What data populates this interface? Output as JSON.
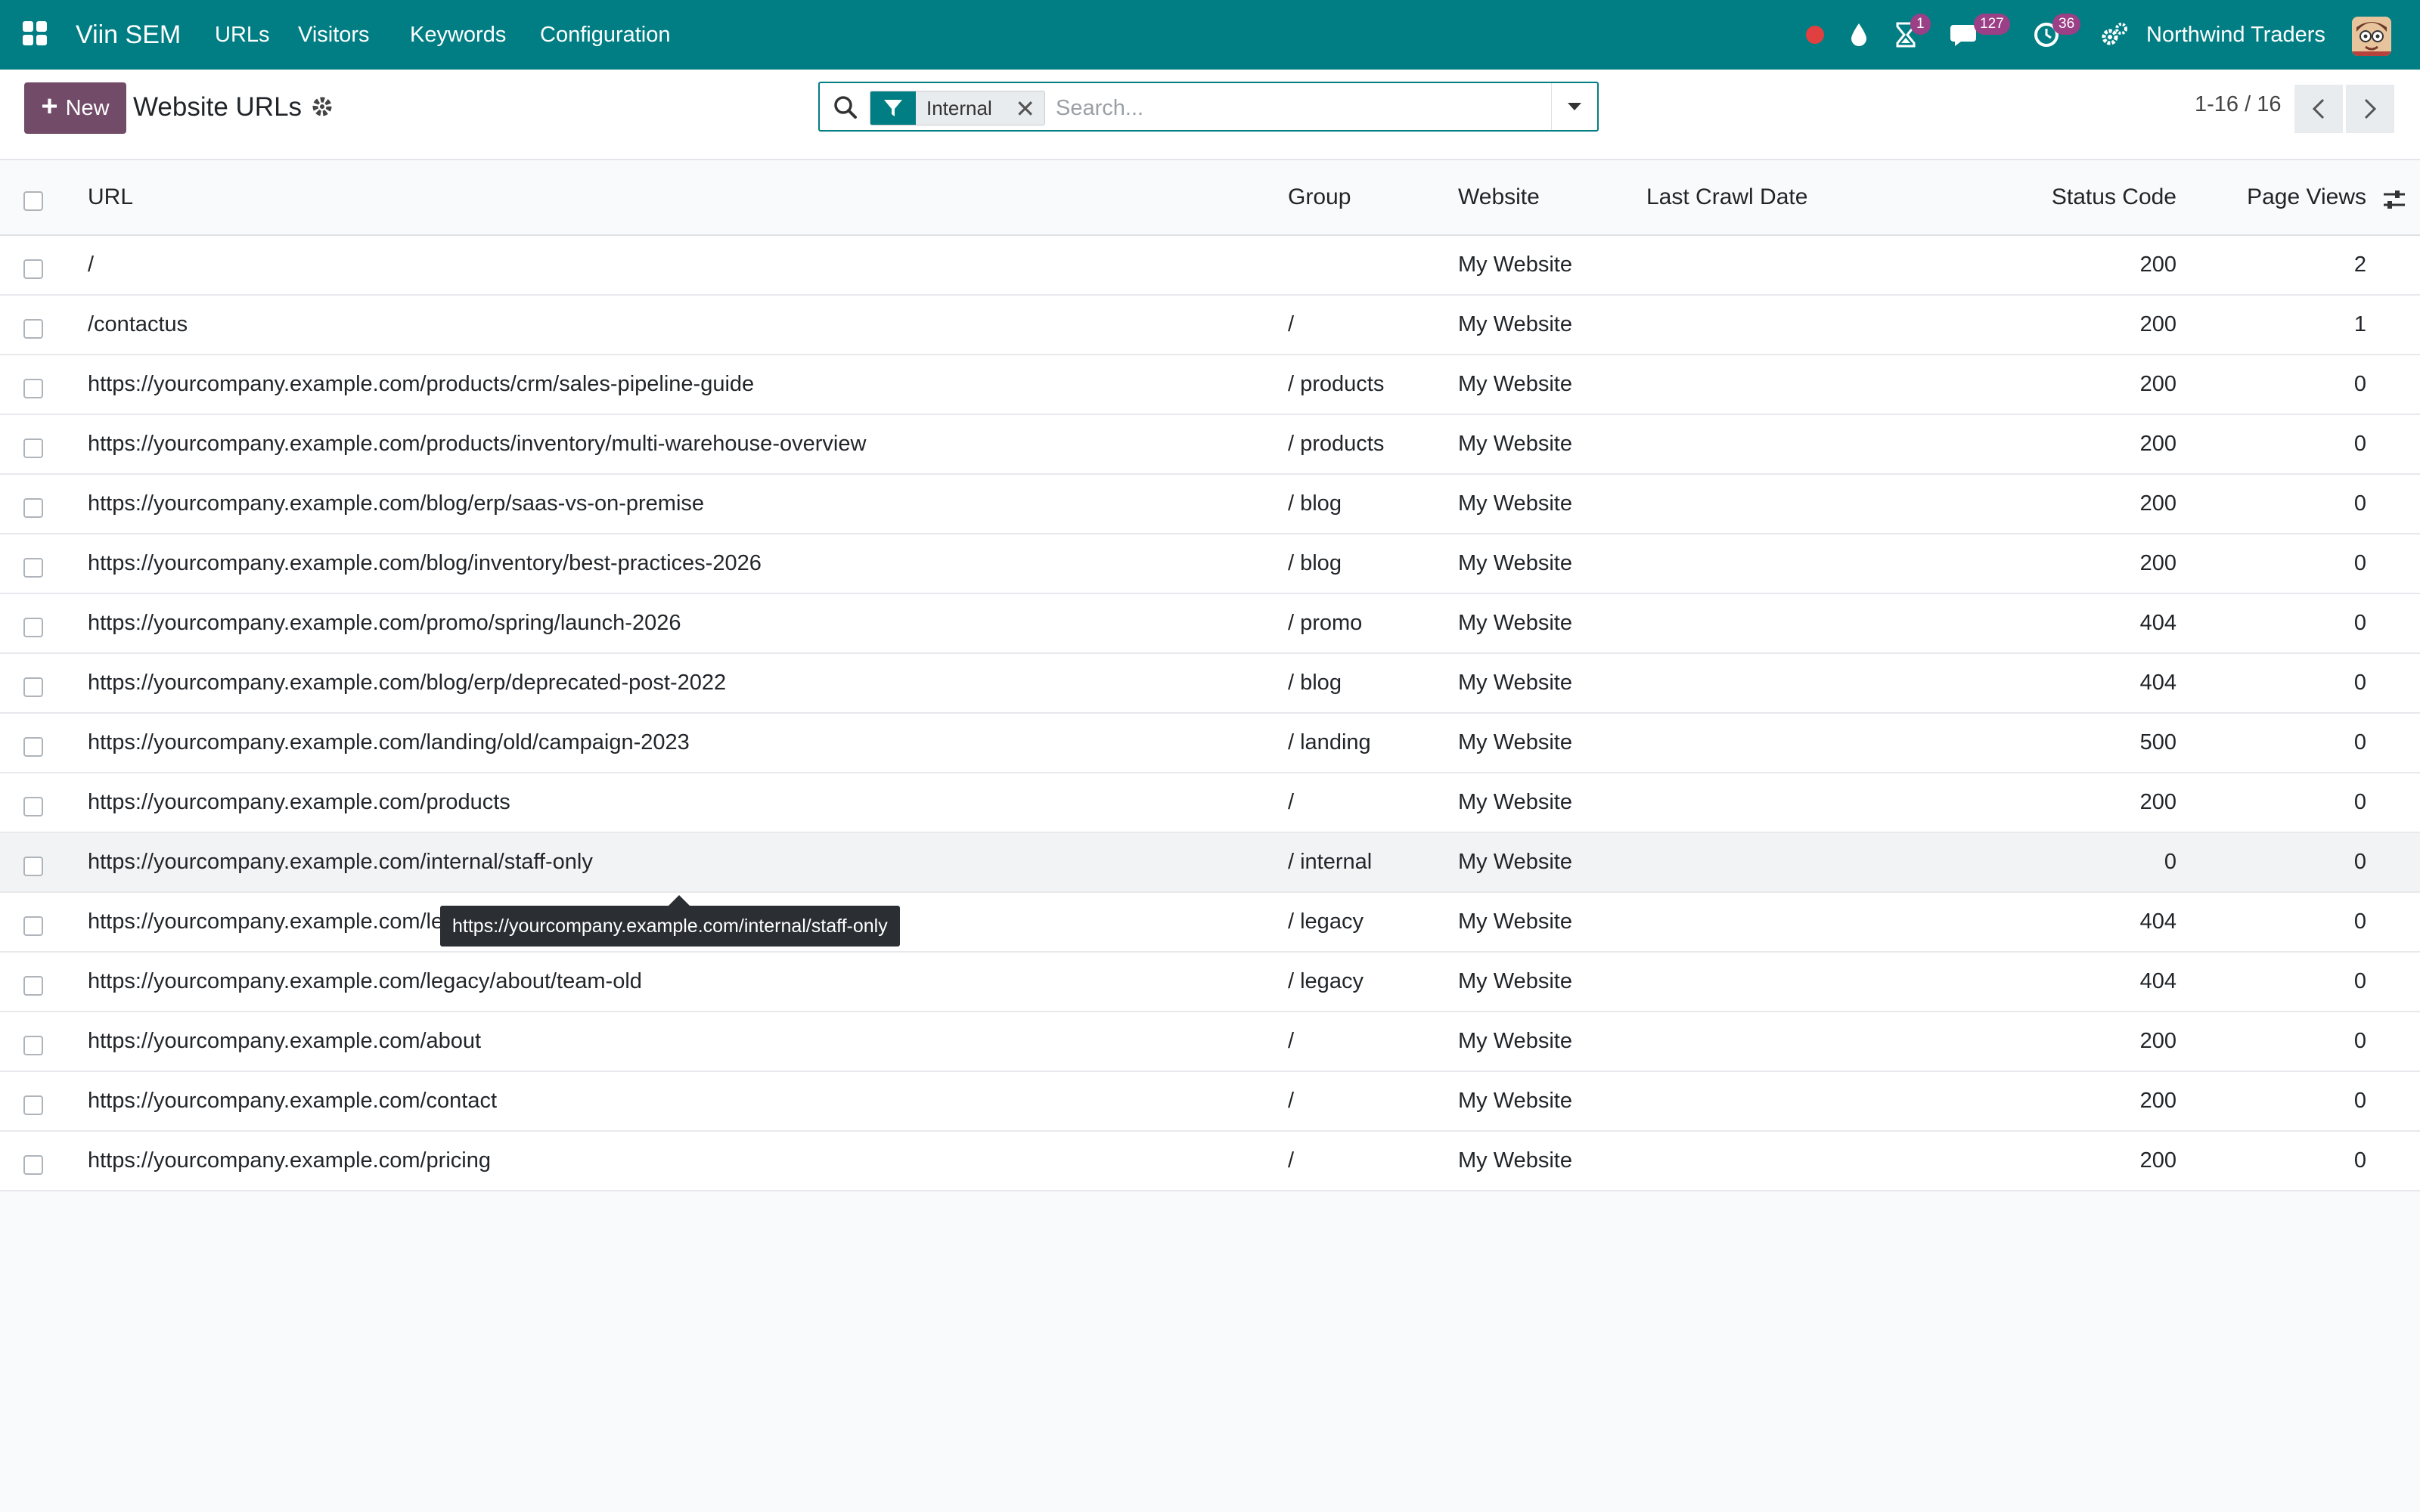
{
  "navbar": {
    "app_name": "Viin SEM",
    "menu": [
      "URLs",
      "Visitors",
      "Keywords",
      "Configuration"
    ],
    "systray": {
      "activity_badge": "1",
      "messages_badge": "127",
      "clock_badge": "36"
    },
    "company": "Northwind Traders",
    "icons": {
      "apps": "grid-icon",
      "record": "red-dot-icon",
      "drop": "drop-icon",
      "activity": "hourglass-icon",
      "messages": "chat-icon",
      "clock": "clock-icon",
      "settings": "gears-icon"
    },
    "colors": {
      "bar": "#017e84",
      "badge": "#9b3f87",
      "record": "#e04040"
    }
  },
  "control_panel": {
    "new_label": "New",
    "title": "Website URLs",
    "search": {
      "facet_label": "Internal",
      "placeholder": "Search..."
    },
    "pager": "1-16 / 16",
    "colors": {
      "new_button": "#714b67"
    }
  },
  "table": {
    "columns": [
      "URL",
      "Group",
      "Website",
      "Last Crawl Date",
      "Status Code",
      "Page Views"
    ],
    "rows": [
      {
        "url": "/",
        "group": "",
        "website": "My Website",
        "crawl": "",
        "status": "200",
        "views": "2"
      },
      {
        "url": "/contactus",
        "group": "/",
        "website": "My Website",
        "crawl": "",
        "status": "200",
        "views": "1"
      },
      {
        "url": "https://yourcompany.example.com/products/crm/sales-pipeline-guide",
        "group": "/ products",
        "website": "My Website",
        "crawl": "",
        "status": "200",
        "views": "0"
      },
      {
        "url": "https://yourcompany.example.com/products/inventory/multi-warehouse-overview",
        "group": "/ products",
        "website": "My Website",
        "crawl": "",
        "status": "200",
        "views": "0"
      },
      {
        "url": "https://yourcompany.example.com/blog/erp/saas-vs-on-premise",
        "group": "/ blog",
        "website": "My Website",
        "crawl": "",
        "status": "200",
        "views": "0"
      },
      {
        "url": "https://yourcompany.example.com/blog/inventory/best-practices-2026",
        "group": "/ blog",
        "website": "My Website",
        "crawl": "",
        "status": "200",
        "views": "0"
      },
      {
        "url": "https://yourcompany.example.com/promo/spring/launch-2026",
        "group": "/ promo",
        "website": "My Website",
        "crawl": "",
        "status": "404",
        "views": "0"
      },
      {
        "url": "https://yourcompany.example.com/blog/erp/deprecated-post-2022",
        "group": "/ blog",
        "website": "My Website",
        "crawl": "",
        "status": "404",
        "views": "0"
      },
      {
        "url": "https://yourcompany.example.com/landing/old/campaign-2023",
        "group": "/ landing",
        "website": "My Website",
        "crawl": "",
        "status": "500",
        "views": "0"
      },
      {
        "url": "https://yourcompany.example.com/products",
        "group": "/",
        "website": "My Website",
        "crawl": "",
        "status": "200",
        "views": "0"
      },
      {
        "url": "https://yourcompany.example.com/internal/staff-only",
        "group": "/ internal",
        "website": "My Website",
        "crawl": "",
        "status": "0",
        "views": "0"
      },
      {
        "url": "https://yourcompany.example.com/legacy/blog/post-2019-42",
        "group": "/ legacy",
        "website": "My Website",
        "crawl": "",
        "status": "404",
        "views": "0"
      },
      {
        "url": "https://yourcompany.example.com/legacy/about/team-old",
        "group": "/ legacy",
        "website": "My Website",
        "crawl": "",
        "status": "404",
        "views": "0"
      },
      {
        "url": "https://yourcompany.example.com/about",
        "group": "/",
        "website": "My Website",
        "crawl": "",
        "status": "200",
        "views": "0"
      },
      {
        "url": "https://yourcompany.example.com/contact",
        "group": "/",
        "website": "My Website",
        "crawl": "",
        "status": "200",
        "views": "0"
      },
      {
        "url": "https://yourcompany.example.com/pricing",
        "group": "/",
        "website": "My Website",
        "crawl": "",
        "status": "200",
        "views": "0"
      }
    ],
    "hover_row": 10
  },
  "tooltip": {
    "text": "https://yourcompany.example.com/internal/staff-only"
  }
}
